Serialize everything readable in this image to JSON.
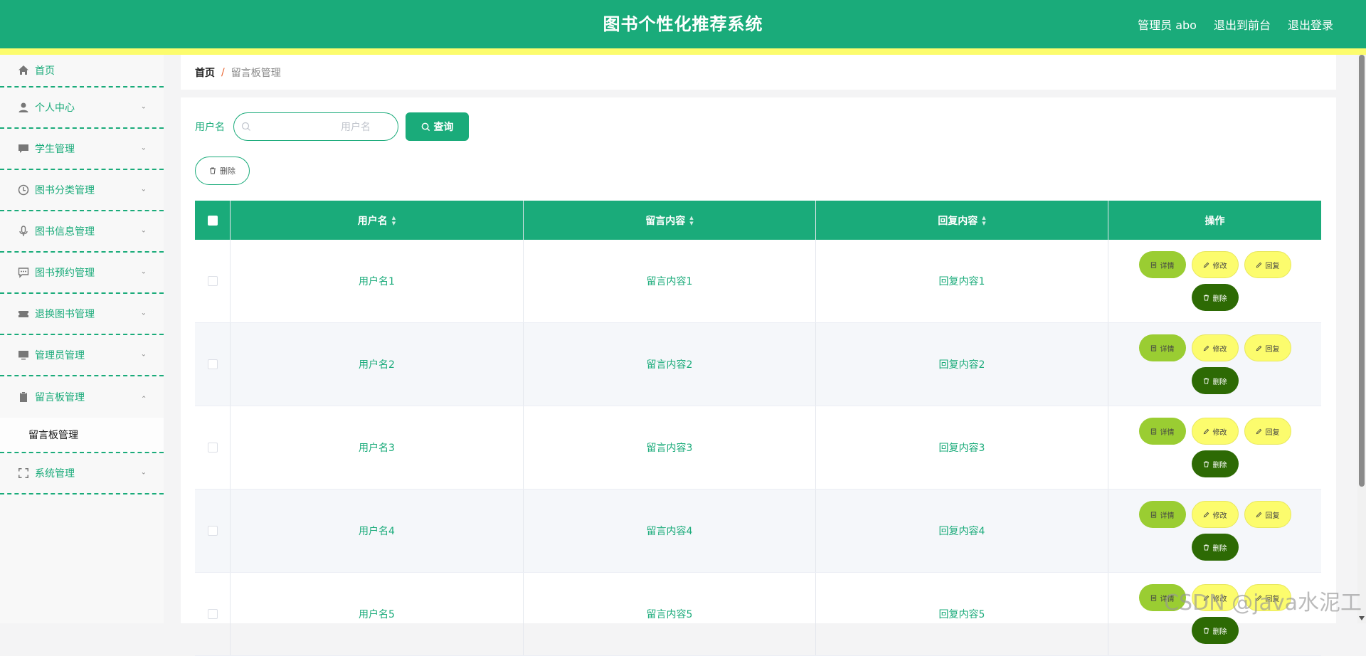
{
  "header": {
    "title": "图书个性化推荐系统",
    "admin": "管理员 abo",
    "front": "退出到前台",
    "logout": "退出登录"
  },
  "sidebar": {
    "home": "首页",
    "items": [
      {
        "label": "个人中心",
        "icon": "user-icon"
      },
      {
        "label": "学生管理",
        "icon": "chat-icon"
      },
      {
        "label": "图书分类管理",
        "icon": "clock-icon"
      },
      {
        "label": "图书信息管理",
        "icon": "mic-icon"
      },
      {
        "label": "图书预约管理",
        "icon": "message-icon"
      },
      {
        "label": "退换图书管理",
        "icon": "ticket-icon"
      },
      {
        "label": "管理员管理",
        "icon": "monitor-icon"
      },
      {
        "label": "留言板管理",
        "icon": "clipboard-icon",
        "expanded": true
      },
      {
        "label": "系统管理",
        "icon": "fullscreen-icon"
      }
    ],
    "submenu": "留言板管理"
  },
  "breadcrumb": {
    "home": "首页",
    "sep": "/",
    "current": "留言板管理"
  },
  "search": {
    "label": "用户名",
    "placeholder": "用户名",
    "button": "查询"
  },
  "toolbar": {
    "delete": "删除"
  },
  "table": {
    "headers": [
      "用户名",
      "留言内容",
      "回复内容",
      "操作"
    ],
    "rows": [
      {
        "user": "用户名1",
        "content": "留言内容1",
        "reply": "回复内容1"
      },
      {
        "user": "用户名2",
        "content": "留言内容2",
        "reply": "回复内容2"
      },
      {
        "user": "用户名3",
        "content": "留言内容3",
        "reply": "回复内容3"
      },
      {
        "user": "用户名4",
        "content": "留言内容4",
        "reply": "回复内容4"
      },
      {
        "user": "用户名5",
        "content": "留言内容5",
        "reply": "回复内容5"
      }
    ],
    "ops": {
      "detail": "详情",
      "edit": "修改",
      "reply": "回复",
      "delete": "删除"
    }
  },
  "watermark": "CSDN @java水泥工",
  "colors": {
    "primary": "#1aab7a",
    "yellow": "#fcfc6d",
    "lime": "#9acd32",
    "dark_green": "#2d6a04"
  }
}
